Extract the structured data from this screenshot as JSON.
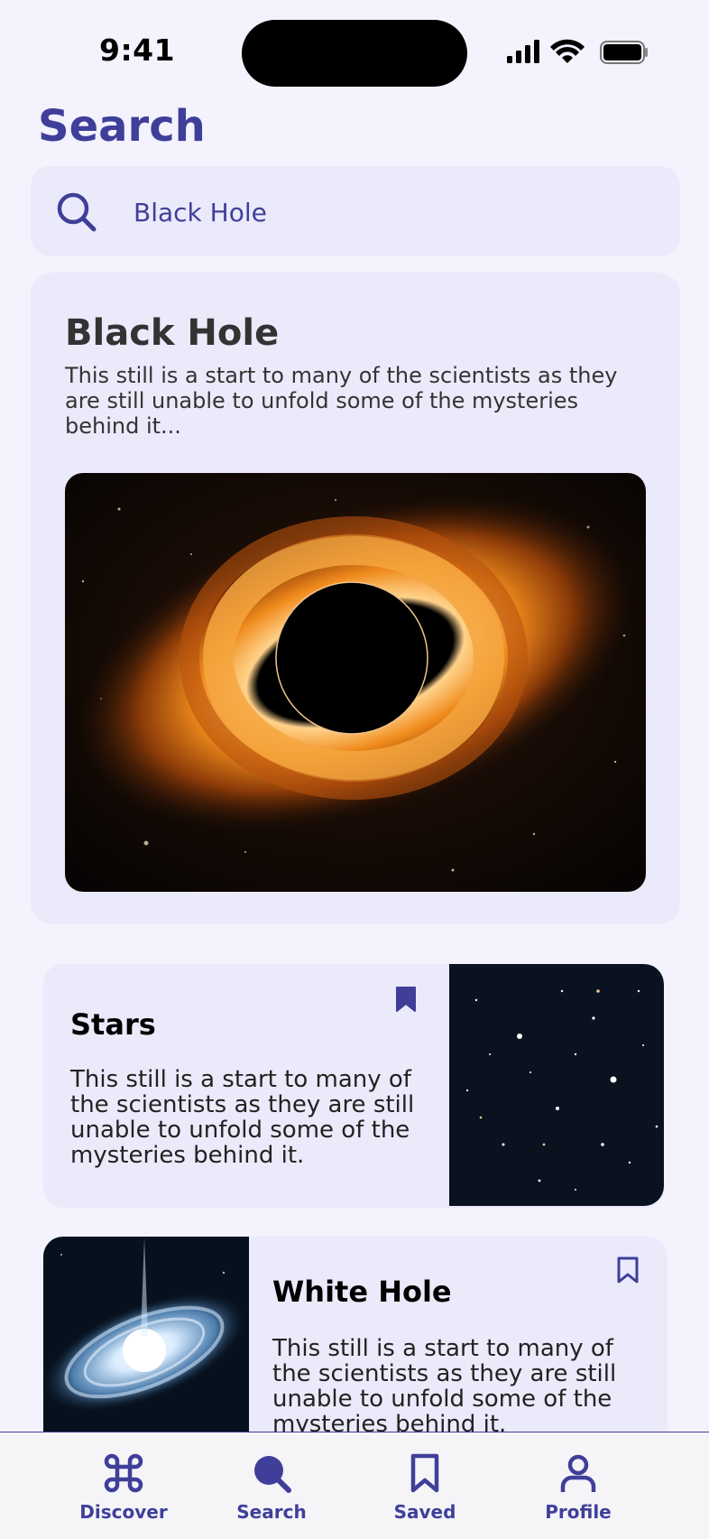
{
  "status_bar": {
    "time": "9:41"
  },
  "page": {
    "title": "Search"
  },
  "search": {
    "value": "Black Hole"
  },
  "featured": {
    "title": "Black Hole",
    "description": "This still is a start to many of the scientists as they are still unable to unfold some of the mysteries behind it...",
    "image_icon": "black-hole-image"
  },
  "results": [
    {
      "title": "Stars",
      "description": "This still is a start to many of the scientists as they are still unable to unfold some of the mysteries behind it.",
      "bookmarked": true,
      "image_icon": "stars-image"
    },
    {
      "title": "White Hole",
      "description": "This still is a start to many of the scientists as they are still unable to unfold some of the mysteries behind it.",
      "bookmarked": false,
      "image_icon": "white-hole-image"
    }
  ],
  "nav": {
    "items": [
      {
        "label": "Discover",
        "icon": "command-icon"
      },
      {
        "label": "Search",
        "icon": "search-icon"
      },
      {
        "label": "Saved",
        "icon": "bookmark-icon"
      },
      {
        "label": "Profile",
        "icon": "person-icon"
      }
    ],
    "active": "Search"
  },
  "colors": {
    "accent": "#3f3f9a",
    "card": "#ebeafb",
    "background": "#f3f2fd"
  }
}
